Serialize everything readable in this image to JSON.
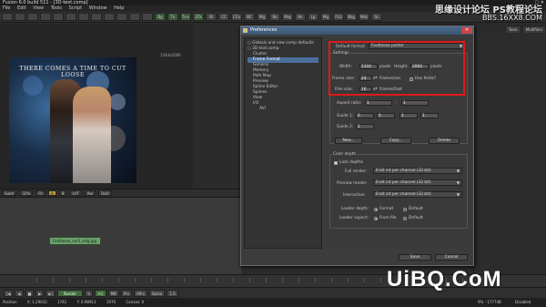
{
  "titlebar": {
    "title": "Fusion 6.0 build 511 - [3D-text.comp]",
    "win_buttons": "_ ▢ ✕"
  },
  "watermarks": {
    "site_cn": "思缘设计论坛",
    "ps": "PS教程论坛",
    "bbs": "BBS.16XX8.COM",
    "uibq": "UiBQ.CoM"
  },
  "menubar": [
    "File",
    "Edit",
    "View",
    "Tools",
    "Script",
    "Window",
    "Help"
  ],
  "toolbar_buttons": [
    "",
    "",
    "",
    "",
    "",
    "",
    "",
    "",
    "",
    "",
    "",
    "",
    "Bg",
    "Tx",
    "Tx+",
    "3Tx",
    "Bl",
    "CC",
    "CCo",
    "BC",
    "Mg",
    "Ro",
    "Mrg",
    "Ke",
    "Lg",
    "Mg",
    "FLU",
    "Bkg",
    "Msk",
    "Sc"
  ],
  "right_tabs": [
    "Tools",
    "Modifiers"
  ],
  "viewer": {
    "resolution_label": "1344x2000",
    "poster_text": "THERE COMES A TIME TO CUT LOOSE"
  },
  "viewer_controls": [
    "SubV",
    "32%",
    "Fit",
    "A",
    "B",
    "LUT",
    "Roi",
    "DoD"
  ],
  "node": {
    "label": "Footloose_ver2_xxlg.jpg"
  },
  "transport": {
    "render": "Render",
    "hq": "HQ",
    "mb": "MB",
    "prx": "Prx",
    "aprx": "APrx",
    "some": "Some",
    "frame": "1.0"
  },
  "statusbar": {
    "position": "Position",
    "x": "X: 1.29032",
    "v1": "1742",
    "y": "Y: 0.98913",
    "v2": "1976",
    "canvas": "Canvas: 0",
    "mem": "9% - 17774B",
    "state": "Disabled"
  },
  "dialog": {
    "title": "Preferences",
    "close": "✕",
    "tree": [
      {
        "label": "Globals and new comp defaults",
        "level": 0
      },
      {
        "label": "3D-text.comp",
        "level": 0
      },
      {
        "label": "Cluster",
        "level": 1
      },
      {
        "label": "Frame Format",
        "level": 1,
        "selected": true
      },
      {
        "label": "General",
        "level": 1
      },
      {
        "label": "Memory",
        "level": 1
      },
      {
        "label": "Path Map",
        "level": 1
      },
      {
        "label": "Preview",
        "level": 1
      },
      {
        "label": "Spline Editor",
        "level": 1
      },
      {
        "label": "Splines",
        "level": 1
      },
      {
        "label": "View",
        "level": 1
      },
      {
        "label": "I/O",
        "level": 1
      },
      {
        "label": "AVI",
        "level": 2
      }
    ],
    "default_format_label": "Default format:",
    "default_format_value": "Footloose poster",
    "settings_label": "Settings",
    "width_label": "Width:",
    "width_value": "1344",
    "width_unit": "pixels",
    "height_label": "Height:",
    "height_value": "2000",
    "height_unit": "pixels",
    "frame_rate_label": "Frame rate:",
    "frame_rate_value": "24",
    "frame_rate_unit": "frames/sec",
    "has_fields_label": "Has fields?",
    "film_size_label": "Film size:",
    "film_size_value": "16",
    "film_size_unit": "frames/foot",
    "aspect_ratio_label": "Aspect ratio:",
    "aspect_a": "1",
    "aspect_sep": ":",
    "aspect_b": "1",
    "guide1_label": "Guide 1:",
    "guide1_values": [
      "0",
      "0",
      "1",
      "1"
    ],
    "guide2_label": "Guide 2:",
    "guide2_value": "1",
    "new_button": "New...",
    "copy_button": "Copy...",
    "delete_button": "Delete",
    "color_depth_label": "Color depth",
    "lock_depth_label": "Lock depths",
    "full_render_label": "Full render:",
    "full_render_value": "8 bit int per channel (32 bit)",
    "preview_render_label": "Preview render:",
    "preview_render_value": "8 bit int per channel (32 bit)",
    "interactive_label": "Interactive:",
    "interactive_value": "8 bit int per channel (32 bit)",
    "loader_depth_label": "Loader depth:",
    "loader_aspect_label": "Loader aspect:",
    "format_opt": "Format",
    "default_opt": "Default",
    "from_file_opt": "From file",
    "default_opt2": "Default",
    "save_button": "Save",
    "cancel_button": "Cancel"
  },
  "colors": {
    "highlight_red": "#e0191b",
    "node_green": "#6ba06b",
    "selected_blue": "#4b6d9a"
  }
}
